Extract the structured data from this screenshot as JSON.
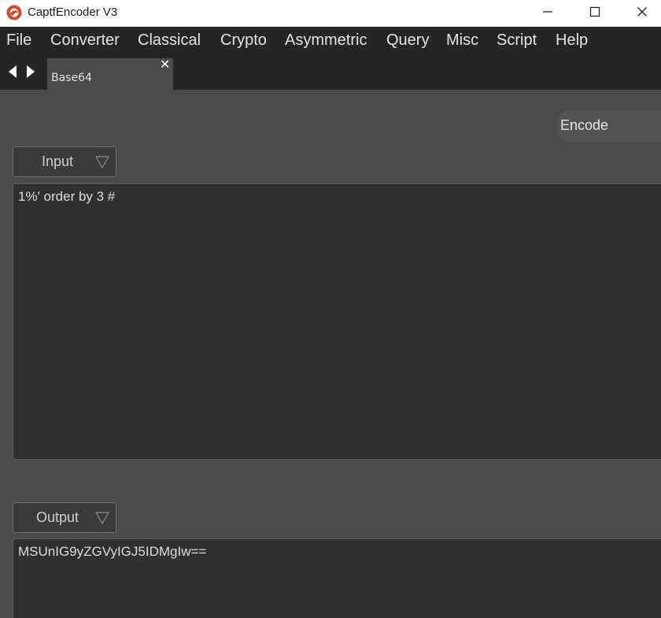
{
  "window": {
    "title": "CaptfEncoder V3",
    "controls": [
      "minimize-icon",
      "maximize-icon",
      "close-icon"
    ]
  },
  "menu": {
    "items": [
      {
        "label": "File"
      },
      {
        "label": "Converter"
      },
      {
        "label": "Classical"
      },
      {
        "label": "Crypto"
      },
      {
        "label": "Asymmetric"
      },
      {
        "label": "Query"
      },
      {
        "label": "Misc"
      },
      {
        "label": "Script"
      },
      {
        "label": "Help"
      }
    ]
  },
  "tabs": {
    "nav_icons": [
      "arrow-left-icon",
      "arrow-right-icon"
    ],
    "items": [
      {
        "label": "Base64",
        "close_icon": "close-icon",
        "close_glyph": "✕"
      }
    ]
  },
  "toolbar": {
    "encode_label": "Encode"
  },
  "input": {
    "dropdown_label": "Input",
    "value": "1%' order by 3 #"
  },
  "output": {
    "dropdown_label": "Output",
    "value": "MSUnIG9yZGVyIGJ5IDMgIw=="
  },
  "colors": {
    "background": "#4b4b4b",
    "menubar": "#252525",
    "text_area": "#303030",
    "logo": "#d9472b"
  }
}
